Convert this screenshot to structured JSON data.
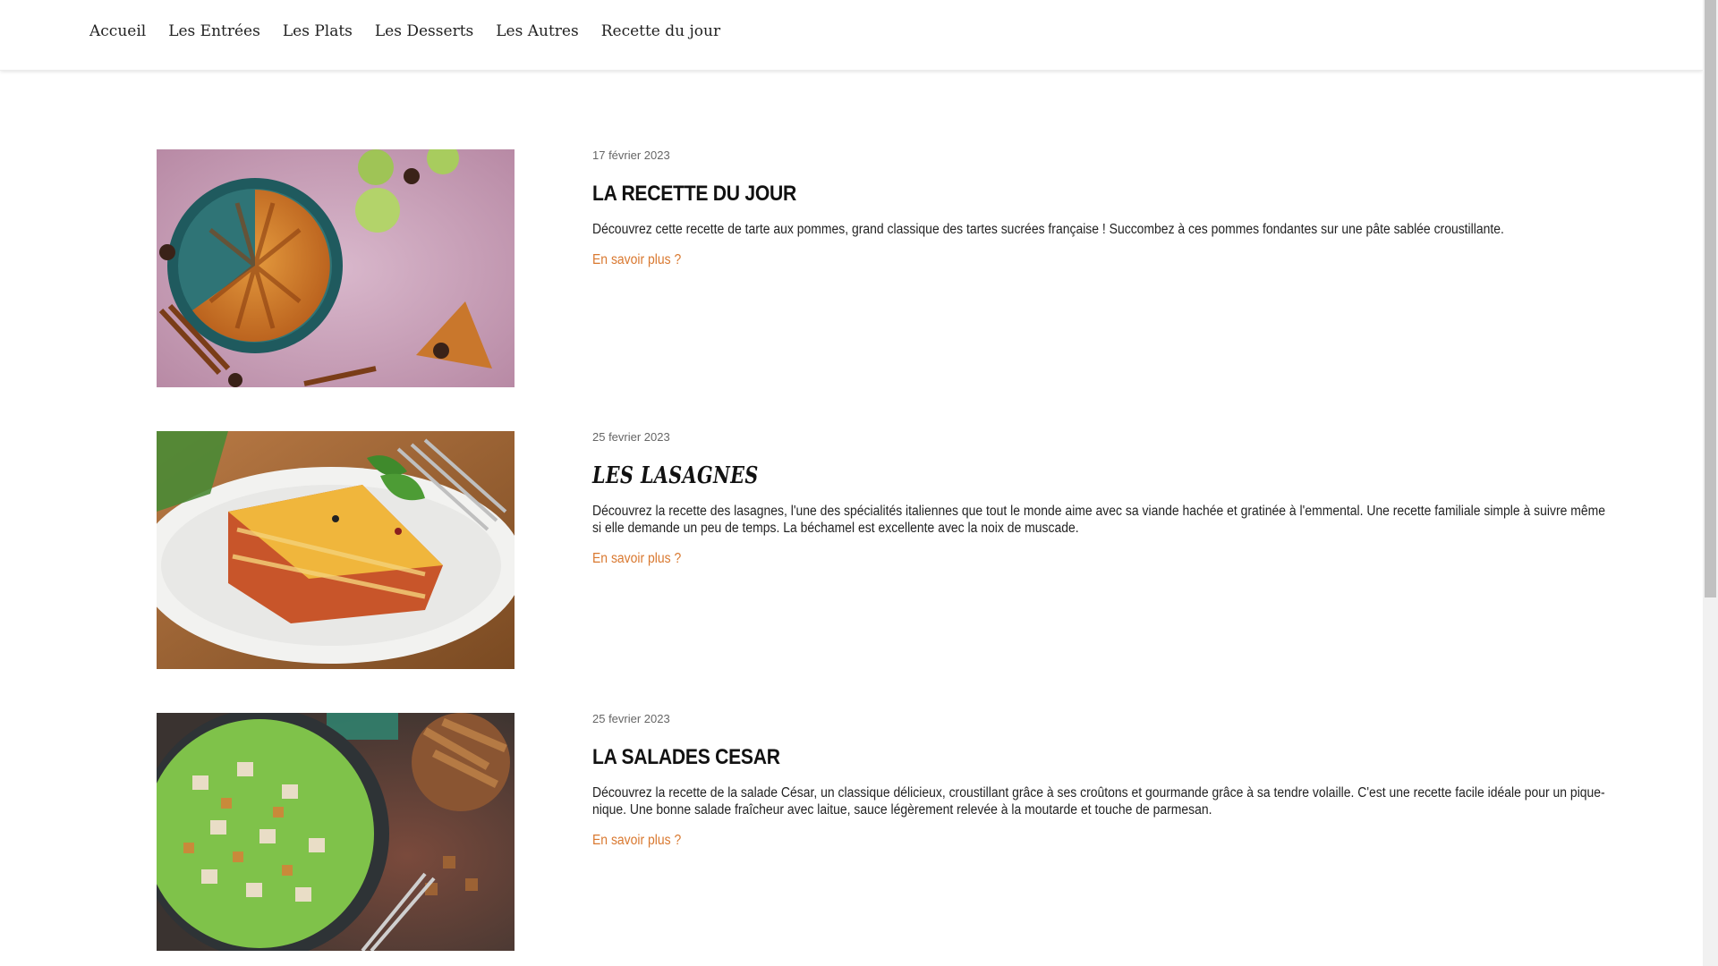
{
  "nav": {
    "items": [
      {
        "label": "Accueil"
      },
      {
        "label": "Les Entrées"
      },
      {
        "label": "Les Plats"
      },
      {
        "label": "Les Desserts"
      },
      {
        "label": "Les Autres"
      },
      {
        "label": "Recette du jour"
      }
    ]
  },
  "articles": [
    {
      "date": "17 février 2023",
      "title": "LA RECETTE DU JOUR",
      "description": "Découvrez cette recette de tarte aux pommes, grand classique des tartes sucrées française ! Succombez à ces pommes fondantes sur une pâte sablée croustillante.",
      "link": "En savoir plus ?",
      "image": "apple-pie-photo"
    },
    {
      "date": "25 fevrier 2023",
      "title": "LES LASAGNES",
      "description": "Découvrez la recette des lasagnes, l'une des spécialités italiennes que tout le monde aime avec sa viande hachée et gratinée à l'emmental. Une recette familiale simple à suivre même si elle demande un peu de temps. La béchamel est excellente avec la noix de muscade.",
      "link": "En savoir plus ?",
      "image": "lasagna-photo"
    },
    {
      "date": "25 fevrier 2023",
      "title": "LA SALADES CESAR",
      "description": "Découvrez la recette de la salade César, un classique délicieux, croustillant grâce à ses croûtons et gourmande grâce à sa tendre volaille. C'est une recette facile idéale pour un pique-nique. Une bonne salade fraîcheur avec laitue, sauce légèrement relevée à la moutarde et touche de parmesan.",
      "link": "En savoir plus ?",
      "image": "caesar-salad-photo"
    }
  ],
  "colors": {
    "accent": "#d9782f",
    "text": "#111111",
    "muted": "#666666"
  }
}
